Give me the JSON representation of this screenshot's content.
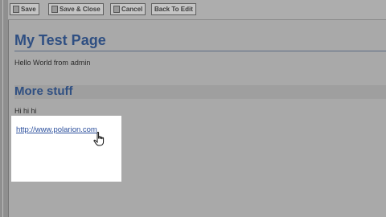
{
  "toolbar": {
    "buttons": [
      {
        "label": "Save"
      },
      {
        "label": "Save & Close"
      },
      {
        "label": "Cancel"
      },
      {
        "label": "Back To Edit"
      }
    ]
  },
  "page": {
    "title": "My Test Page",
    "greeting": "Hello World from",
    "user": "admin",
    "section_title": "More stuff",
    "section_text": "Hi hi hi",
    "link_text": "http://www.polarion.com"
  },
  "colors": {
    "heading": "#2f4f82",
    "link": "#2a4e9c",
    "background": "#a9a9a9"
  }
}
